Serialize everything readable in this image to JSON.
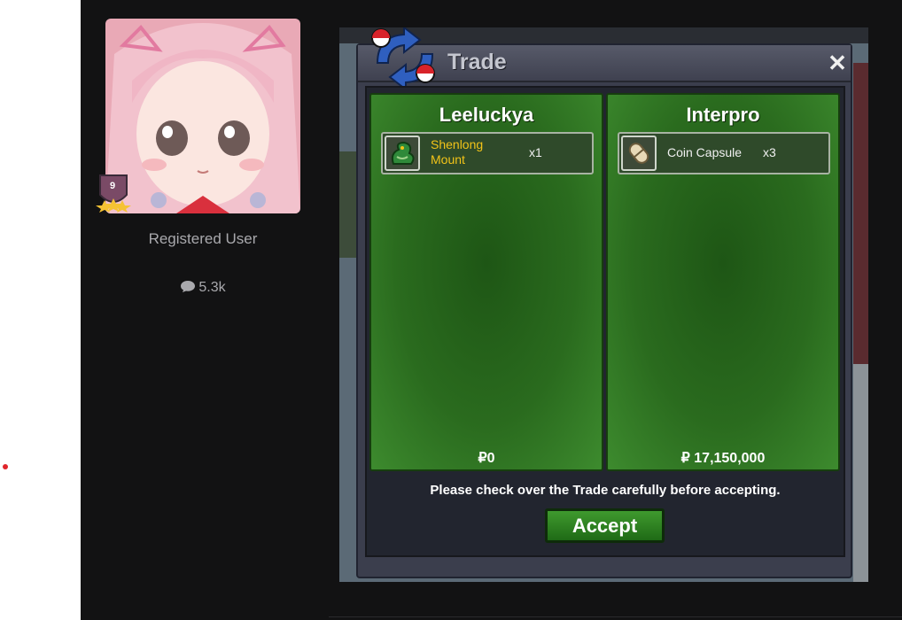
{
  "author": {
    "rank_level": "9",
    "user_title": "Registered User",
    "post_count": "5.3k",
    "post_count_icon": "comment-icon"
  },
  "trade": {
    "title": "Trade",
    "close_symbol": "✕",
    "left_panel": {
      "player": "Leeluckya",
      "item_name": "Shenlong Mount",
      "item_quantity": "x1",
      "item_icon": "shenlong-mount-icon",
      "money": "₽0"
    },
    "right_panel": {
      "player": "Interpro",
      "item_name": "Coin Capsule",
      "item_quantity": "x3",
      "item_icon": "coin-capsule-icon",
      "money": "₽ 17,150,000"
    },
    "notice": "Please check over the Trade carefully before accepting.",
    "accept_label": "Accept"
  },
  "colors": {
    "page_background": "#121213",
    "panel_green": "#2a6b1e",
    "item_gold": "#f2c318",
    "accent_red_dot": "#e0252b"
  }
}
